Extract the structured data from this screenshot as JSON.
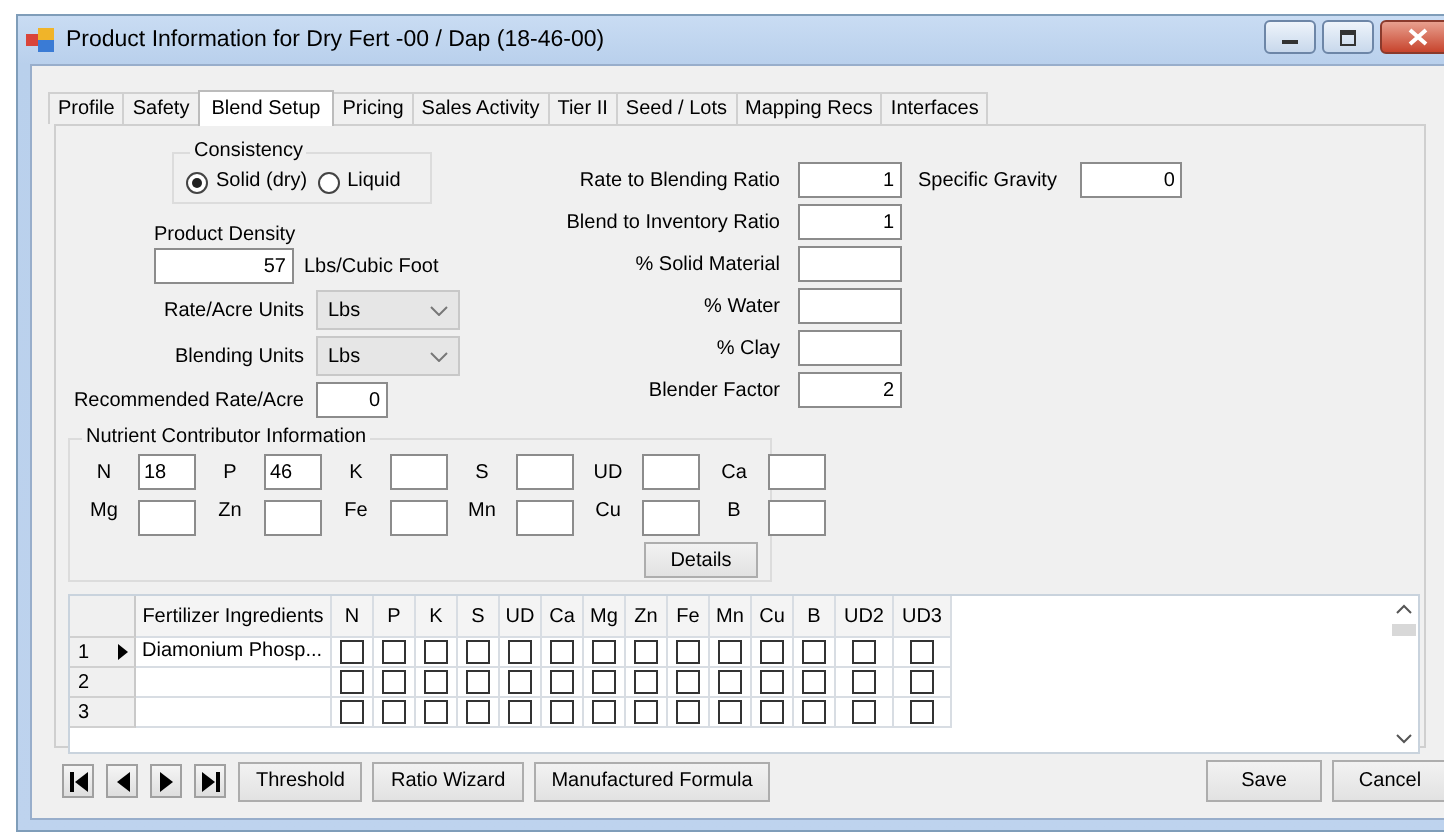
{
  "window": {
    "title": "Product Information for Dry Fert -00 / Dap (18-46-00)"
  },
  "tabs": [
    {
      "label": "Profile",
      "selected": false
    },
    {
      "label": "Safety",
      "selected": false
    },
    {
      "label": "Blend Setup",
      "selected": true
    },
    {
      "label": "Pricing",
      "selected": false
    },
    {
      "label": "Sales Activity",
      "selected": false
    },
    {
      "label": "Tier II",
      "selected": false
    },
    {
      "label": "Seed / Lots",
      "selected": false
    },
    {
      "label": "Mapping Recs",
      "selected": false
    },
    {
      "label": "Interfaces",
      "selected": false
    }
  ],
  "consistency": {
    "label": "Consistency",
    "options": [
      {
        "label": "Solid (dry)",
        "selected": true
      },
      {
        "label": "Liquid",
        "selected": false
      }
    ]
  },
  "product_density": {
    "label": "Product Density",
    "value": "57",
    "unit": "Lbs/Cubic Foot"
  },
  "unit_fields": [
    {
      "label": "Rate/Acre Units",
      "value": "Lbs"
    },
    {
      "label": "Blending Units",
      "value": "Lbs"
    }
  ],
  "recommended_rate": {
    "label": "Recommended Rate/Acre",
    "value": "0"
  },
  "ratio_fields": [
    {
      "label": "Rate to Blending Ratio",
      "value": "1"
    },
    {
      "label": "Blend to Inventory Ratio",
      "value": "1"
    },
    {
      "label": "% Solid Material"
    },
    {
      "label": "% Water"
    },
    {
      "label": "% Clay"
    },
    {
      "label": "Blender Factor",
      "value": "2"
    }
  ],
  "specific_gravity": {
    "label": "Specific Gravity",
    "value": "0"
  },
  "nutrients": {
    "title": "Nutrient Contributor Information",
    "details_button": "Details",
    "fields": [
      {
        "label": "N",
        "value": "18"
      },
      {
        "label": "P",
        "value": "46"
      },
      {
        "label": "K"
      },
      {
        "label": "S"
      },
      {
        "label": "UD"
      },
      {
        "label": "Ca"
      },
      {
        "label": "Mg"
      },
      {
        "label": "Zn"
      },
      {
        "label": "Fe"
      },
      {
        "label": "Mn"
      },
      {
        "label": "Cu"
      },
      {
        "label": "B"
      }
    ]
  },
  "grid": {
    "columns": [
      "Fertilizer Ingredients",
      "N",
      "P",
      "K",
      "S",
      "UD",
      "Ca",
      "Mg",
      "Zn",
      "Fe",
      "Mn",
      "Cu",
      "B",
      "UD2",
      "UD3"
    ],
    "rows": [
      {
        "number": "1",
        "current": true,
        "ingredient": "Diamonium Phosp...",
        "checks": [
          false,
          false,
          false,
          false,
          false,
          false,
          false,
          false,
          false,
          false,
          false,
          false,
          false,
          false
        ]
      },
      {
        "number": "2",
        "current": false,
        "checks": [
          false,
          false,
          false,
          false,
          false,
          false,
          false,
          false,
          false,
          false,
          false,
          false,
          false,
          false
        ]
      },
      {
        "number": "3",
        "current": false,
        "checks": [
          false,
          false,
          false,
          false,
          false,
          false,
          false,
          false,
          false,
          false,
          false,
          false,
          false,
          false
        ]
      }
    ]
  },
  "buttons": [
    "Threshold",
    "Ratio Wizard",
    "Manufactured Formula"
  ],
  "dialog_buttons": [
    "Save",
    "Cancel"
  ]
}
